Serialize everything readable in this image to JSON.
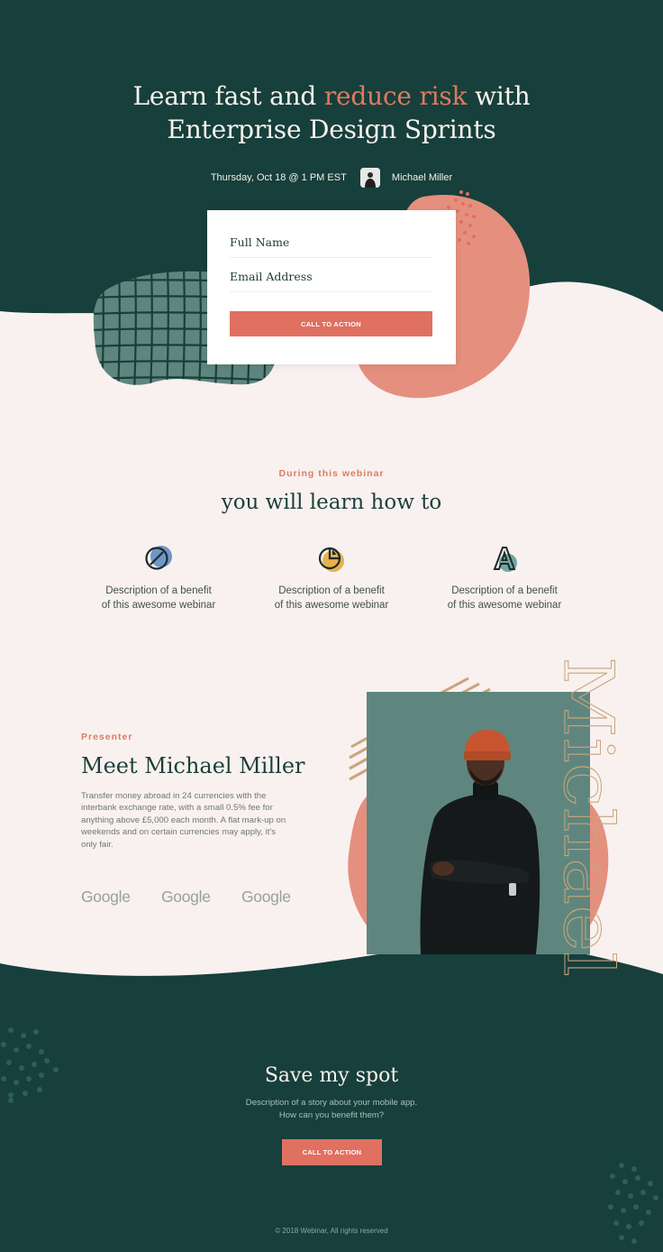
{
  "hero": {
    "title_part1": "Learn fast and ",
    "title_accent": "reduce risk",
    "title_part2": " with",
    "title_line2": "Enterprise Design Sprints",
    "date": "Thursday, Oct 18 @ 1 PM EST",
    "presenter_name": "Michael Miller"
  },
  "form": {
    "full_name_label": "Full Name",
    "email_label": "Email Address",
    "button_label": "CALL TO ACTION"
  },
  "benefits": {
    "eyebrow": "During this webinar",
    "title": "you will learn how to",
    "items": [
      {
        "line1": "Description of a benefit",
        "line2": "of this awesome webinar",
        "icon": "circle-slash-icon"
      },
      {
        "line1": "Description of a benefit",
        "line2": "of this awesome webinar",
        "icon": "pie-chart-icon"
      },
      {
        "line1": "Description of a benefit",
        "line2": "of this awesome webinar",
        "icon": "letter-a-icon"
      }
    ]
  },
  "presenter": {
    "eyebrow": "Presenter",
    "title": "Meet Michael Miller",
    "description": "Transfer money abroad in 24 currencies with the interbank exchange rate, with a small 0.5% fee for anything above £5,000 each month. A flat mark-up on weekends and on certain currencies may apply, it's only fair.",
    "logos": [
      "Google",
      "Google",
      "Google"
    ],
    "vertical_name": "Michael"
  },
  "cta": {
    "title": "Save my spot",
    "description_line1": "Description of a story about your mobile app.",
    "description_line2": "How can you benefit them?",
    "button_label": "CALL TO ACTION"
  },
  "footer": {
    "copyright": "© 2018 Webinar, All rights reserved"
  },
  "colors": {
    "dark_green": "#173f3b",
    "accent": "#e07060",
    "cream": "#f8f1ef",
    "sage": "#5f867e",
    "salmon": "#e58f7f"
  }
}
